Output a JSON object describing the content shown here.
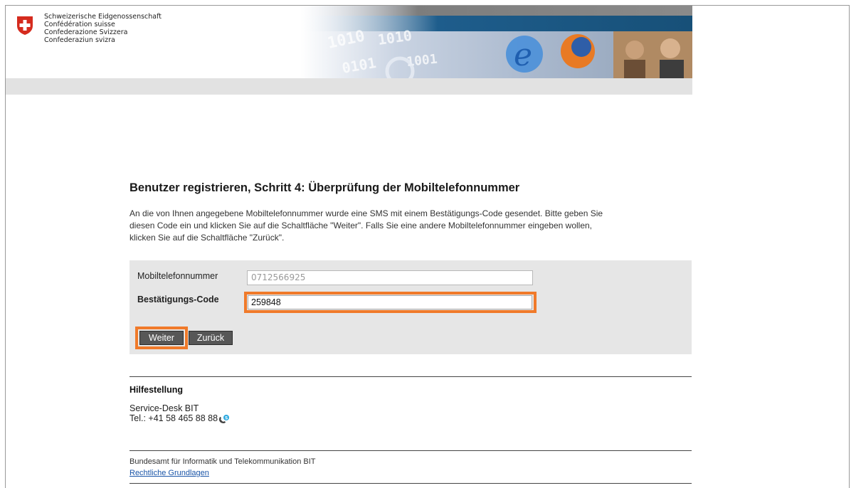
{
  "header": {
    "confederation_lines": [
      "Schweizerische Eidgenossenschaft",
      "Confédération suisse",
      "Confederazione Svizzera",
      "Confederaziun svizra"
    ],
    "banner_binary_text": "1010 1010 0101 1001"
  },
  "main": {
    "title": "Benutzer registrieren, Schritt 4: Überprüfung der Mobiltelefonnummer",
    "intro_lines": [
      "An die von Ihnen angegebene Mobiltelefonnummer wurde eine SMS mit einem Bestätigungs-Code gesendet. Bitte geben Sie",
      "diesen Code ein und klicken Sie auf die Schaltfläche \"Weiter\". Falls Sie eine andere Mobiltelefonnummer eingeben wollen,",
      "klicken Sie auf die Schaltfläche \"Zurück\"."
    ]
  },
  "form": {
    "mobile_label": "Mobiltelefonnummer",
    "mobile_value": "0712566925",
    "code_label": "Bestätigungs-Code",
    "code_value": "259848",
    "weiter_label": "Weiter",
    "zurueck_label": "Zurück",
    "highlight_color": "#f07a2a",
    "button_color": "#575757"
  },
  "help": {
    "title": "Hilfestellung",
    "service_desk": "Service-Desk BIT",
    "phone": "Tel.: +41 58 465 88 88",
    "phone_icon": "skype-call-icon"
  },
  "footer": {
    "org": "Bundesamt für Informatik und Telekommunikation BIT",
    "legal_link": "Rechtliche Grundlagen"
  }
}
